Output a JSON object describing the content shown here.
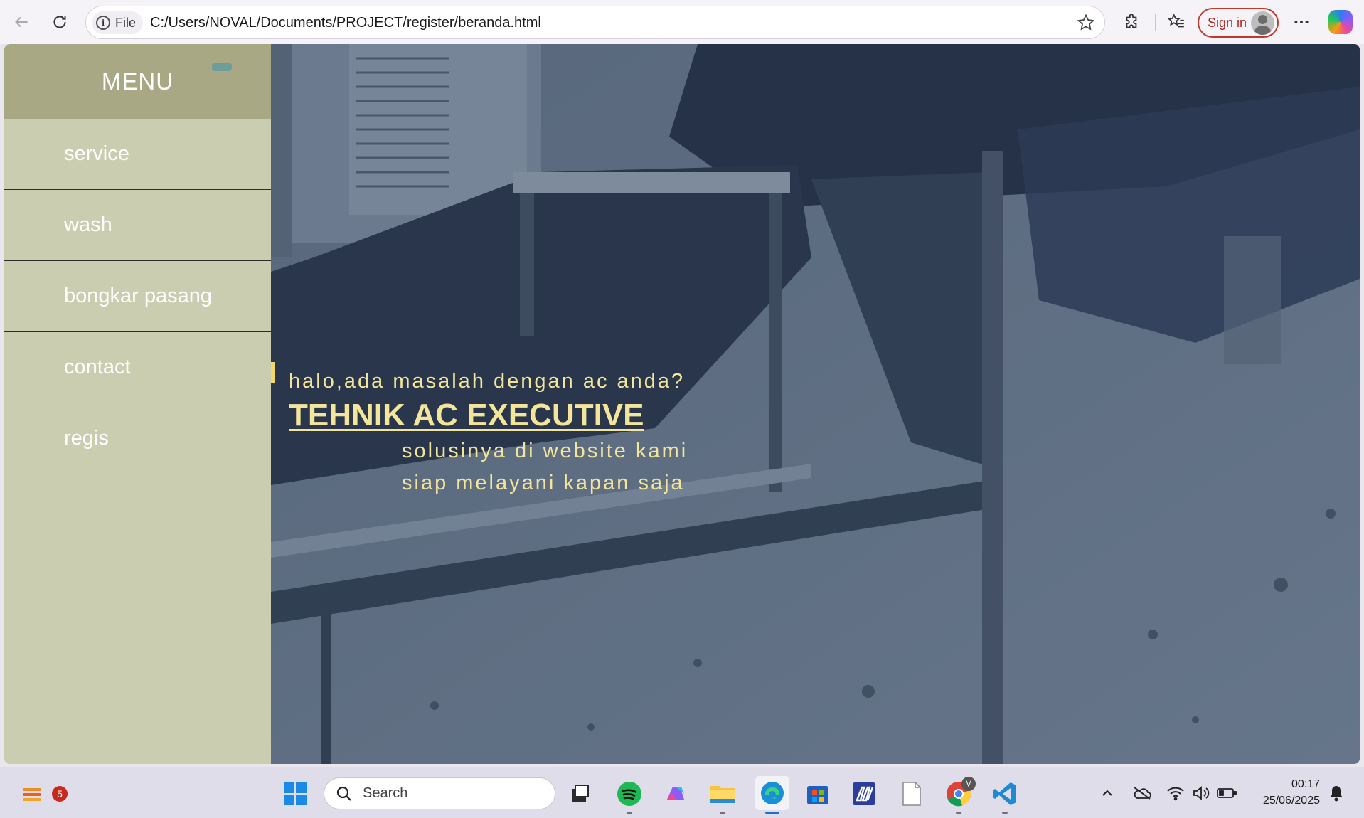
{
  "browser": {
    "file_chip": "File",
    "url": "C:/Users/NOVAL/Documents/PROJECT/register/beranda.html",
    "signin_label": "Sign in"
  },
  "sidebar": {
    "title": "MENU",
    "items": [
      {
        "label": "service"
      },
      {
        "label": "wash"
      },
      {
        "label": "bongkar pasang"
      },
      {
        "label": "contact"
      },
      {
        "label": "regis"
      }
    ]
  },
  "hero": {
    "tagline": "halo,ada masalah dengan ac anda?",
    "brand": "TEHNIK AC EXECUTIVE",
    "sub1": "solusinya di website kami",
    "sub2": "siap melayani kapan saja"
  },
  "taskbar": {
    "search_placeholder": "Search",
    "notification_badge": "5",
    "chrome_profile_badge": "M",
    "time": "00:17",
    "date": "25/06/2025"
  },
  "colors": {
    "sidebar_bg": "#cbcdb0",
    "menu_head_bg": "#a8a984",
    "hero_text": "#f3e59a",
    "accent": "#f3d66c",
    "signin_border": "#c0392b"
  }
}
